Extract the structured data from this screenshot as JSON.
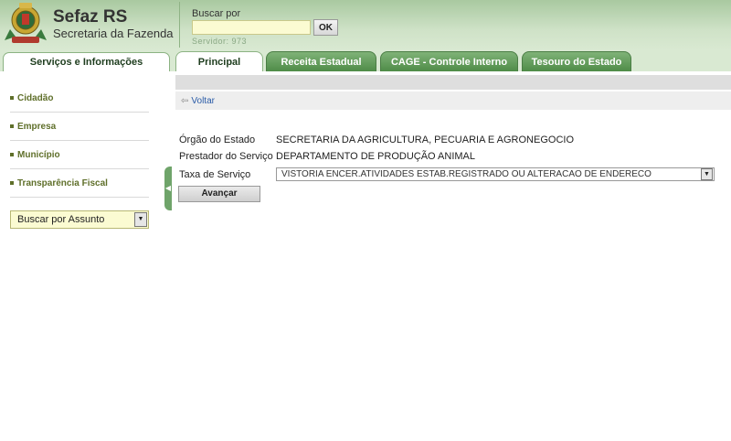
{
  "header": {
    "brand_title": "Sefaz RS",
    "brand_subtitle": "Secretaria da Fazenda",
    "search_label": "Buscar por",
    "search_value": "",
    "ok_label": "OK",
    "server_text": "Servidor: 973"
  },
  "tabs": {
    "side": "Serviços e Informações",
    "main": "Principal",
    "receita": "Receita Estadual",
    "cage": "CAGE - Controle Interno",
    "tesouro": "Tesouro do Estado",
    "active": "Principal"
  },
  "sidebar": {
    "items": [
      {
        "label": "Cidadão"
      },
      {
        "label": "Empresa"
      },
      {
        "label": "Município"
      },
      {
        "label": "Transparência Fiscal"
      }
    ],
    "subject_select": "Buscar por Assunto"
  },
  "content": {
    "back_label": "Voltar",
    "orgao_label": "Órgão do Estado",
    "orgao_value": "SECRETARIA DA AGRICULTURA, PECUARIA E AGRONEGOCIO",
    "prestador_label": "Prestador do Serviço",
    "prestador_value": "DEPARTAMENTO DE PRODUÇÃO ANIMAL",
    "taxa_label": "Taxa de Serviço",
    "taxa_value": "VISTORIA ENCER.ATIVIDADES ESTAB.REGISTRADO OU ALTERACAO DE ENDERECO",
    "advance_label": "Avançar"
  },
  "colors": {
    "header_green": "#a9c9a0",
    "tab_green": "#4f8c48",
    "link_blue": "#2b5ca8",
    "sidebar_text": "#5f6f2a"
  },
  "icons": {
    "logo": "rs-coat-of-arms-icon",
    "back": "back-arrow-icon",
    "dropdown": "chevron-down-icon",
    "collapse": "collapse-left-icon"
  }
}
